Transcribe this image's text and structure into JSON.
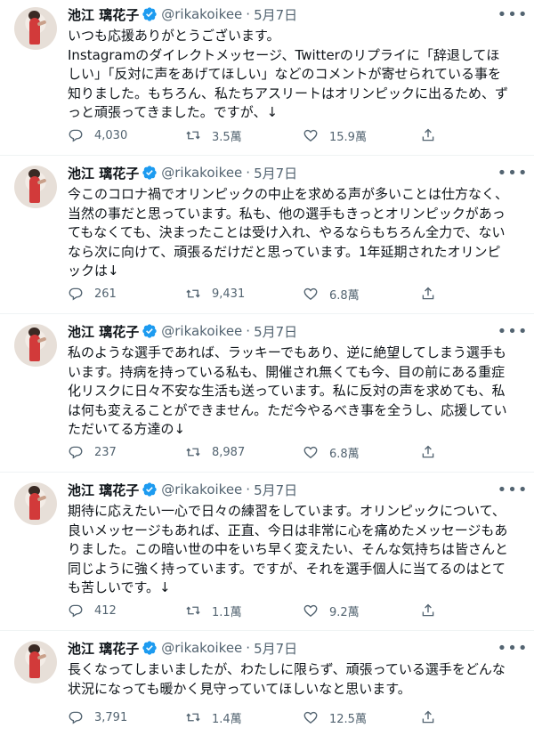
{
  "author": {
    "name": "池江 璃花子",
    "handle": "@rikakoikee",
    "separator": "·"
  },
  "more_glyph": "•••",
  "tweets": [
    {
      "date": "5月7日",
      "text": "いつも応援ありがとうございます。\nInstagramのダイレクトメッセージ、Twitterのリプライに「辞退してほしい」「反対に声をあげてほしい」などのコメントが寄せられている事を知りました。もちろん、私たちアスリートはオリンピックに出るため、ずっと頑張ってきました。ですが、↓",
      "replies": "4,030",
      "retweets": "3.5萬",
      "likes": "15.9萬"
    },
    {
      "date": "5月7日",
      "text": "今このコロナ禍でオリンピックの中止を求める声が多いことは仕方なく、当然の事だと思っています。私も、他の選手もきっとオリンピックがあってもなくても、決まったことは受け入れ、やるならもちろん全力で、ないなら次に向けて、頑張るだけだと思っています。1年延期されたオリンピックは↓",
      "replies": "261",
      "retweets": "9,431",
      "likes": "6.8萬"
    },
    {
      "date": "5月7日",
      "text": "私のような選手であれば、ラッキーでもあり、逆に絶望してしまう選手もいます。持病を持っている私も、開催され無くても今、目の前にある重症化リスクに日々不安な生活も送っています。私に反対の声を求めても、私は何も変えることができません。ただ今やるべき事を全うし、応援していただいてる方達の↓",
      "replies": "237",
      "retweets": "8,987",
      "likes": "6.8萬"
    },
    {
      "date": "5月7日",
      "text": "期待に応えたい一心で日々の練習をしています。オリンピックについて、良いメッセージもあれば、正直、今日は非常に心を痛めたメッセージもありました。この暗い世の中をいち早く変えたい、そんな気持ちは皆さんと同じように強く持っています。ですが、それを選手個人に当てるのはとても苦しいです。↓",
      "replies": "412",
      "retweets": "1.1萬",
      "likes": "9.2萬"
    },
    {
      "date": "5月7日",
      "text": "長くなってしまいましたが、わたしに限らず、頑張っている選手をどんな状況になっても暖かく見守っていてほしいなと思います。",
      "replies": "3,791",
      "retweets": "1.4萬",
      "likes": "12.5萬"
    }
  ],
  "icons": {
    "reply": "reply-icon",
    "retweet": "retweet-icon",
    "like": "heart-icon",
    "share": "share-icon",
    "verified": "verified-badge-icon",
    "more": "more-icon"
  },
  "colors": {
    "text": "#0f1419",
    "secondary": "#536471",
    "verified": "#1d9bf0",
    "divider": "#eff3f4"
  }
}
